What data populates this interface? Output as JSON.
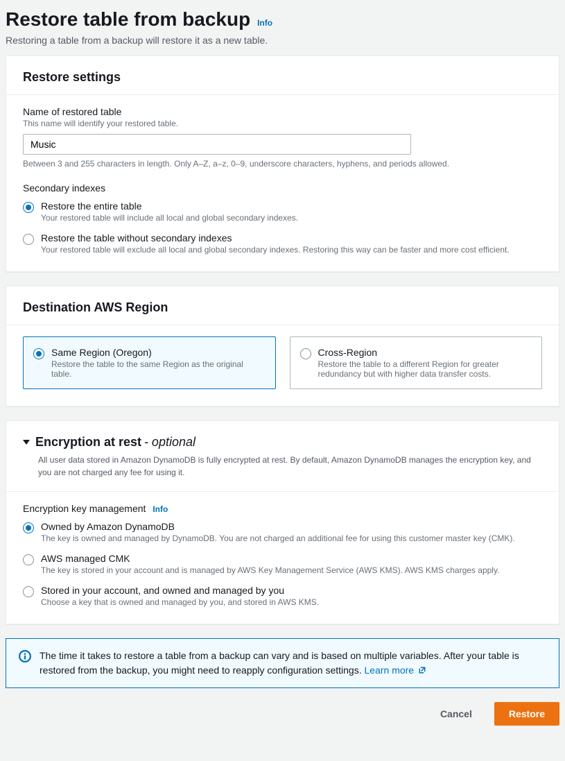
{
  "header": {
    "title": "Restore table from backup",
    "info_label": "Info",
    "subtitle": "Restoring a table from a backup will restore it as a new table."
  },
  "restore_settings": {
    "panel_title": "Restore settings",
    "name_label": "Name of restored table",
    "name_hint": "This name will identify your restored table.",
    "name_value": "Music",
    "name_constraint": "Between 3 and 255 characters in length. Only A–Z, a–z, 0–9, underscore characters, hyphens, and periods allowed.",
    "secondary_indexes_label": "Secondary indexes",
    "secondary_indexes_options": [
      {
        "title": "Restore the entire table",
        "desc": "Your restored table will include all local and global secondary indexes.",
        "selected": true
      },
      {
        "title": "Restore the table without secondary indexes",
        "desc": "Your restored table will exclude all local and global secondary indexes. Restoring this way can be faster and more cost efficient.",
        "selected": false
      }
    ]
  },
  "destination_region": {
    "panel_title": "Destination AWS Region",
    "options": [
      {
        "title": "Same Region (Oregon)",
        "desc": "Restore the table to the same Region as the original table.",
        "selected": true
      },
      {
        "title": "Cross-Region",
        "desc": "Restore the table to a different Region for greater redundancy but with higher data transfer costs.",
        "selected": false
      }
    ]
  },
  "encryption": {
    "title": "Encryption at rest",
    "optional_label": "- optional",
    "desc": "All user data stored in Amazon DynamoDB is fully encrypted at rest. By default, Amazon DynamoDB manages the encryption key, and you are not charged any fee for using it.",
    "key_mgmt_label": "Encryption key management",
    "info_label": "Info",
    "options": [
      {
        "title": "Owned by Amazon DynamoDB",
        "desc": "The key is owned and managed by DynamoDB. You are not charged an additional fee for using this customer master key (CMK).",
        "selected": true
      },
      {
        "title": "AWS managed CMK",
        "desc": "The key is stored in your account and is managed by AWS Key Management Service (AWS KMS). AWS KMS charges apply.",
        "selected": false
      },
      {
        "title": "Stored in your account, and owned and managed by you",
        "desc": "Choose a key that is owned and managed by you, and stored in AWS KMS.",
        "selected": false
      }
    ]
  },
  "alert": {
    "text": "The time it takes to restore a table from a backup can vary and is based on multiple variables. After your table is restored from the backup, you might need to reapply configuration settings. ",
    "learn_more": "Learn more"
  },
  "footer": {
    "cancel": "Cancel",
    "restore": "Restore"
  }
}
